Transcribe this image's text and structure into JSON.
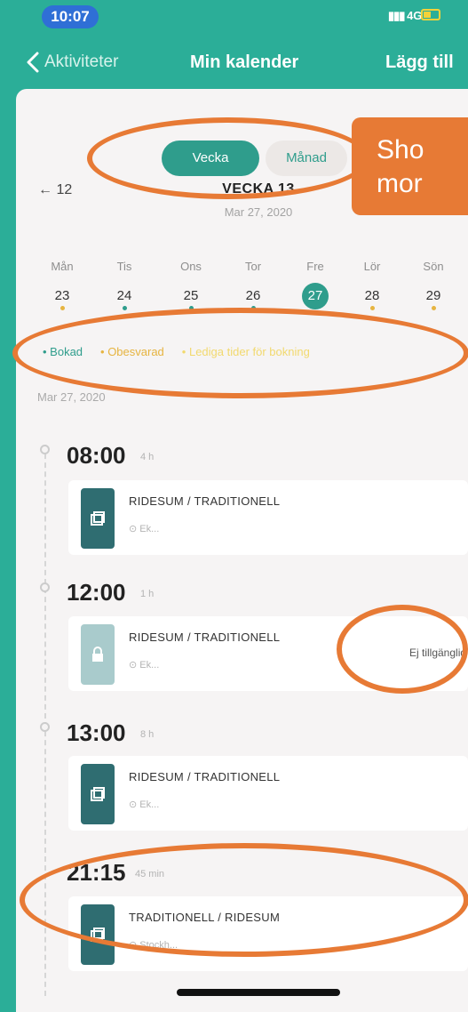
{
  "status_bar": {
    "time": "10:07",
    "network": "4G"
  },
  "nav": {
    "back_label": "Aktiviteter",
    "title": "Min kalender",
    "add_label": "Lägg till"
  },
  "view_toggle": {
    "week": "Vecka",
    "month": "Månad",
    "selected": "Vecka"
  },
  "week": {
    "prev": "← 12",
    "title": "VECKA 13",
    "date": "Mar 27, 2020"
  },
  "days": [
    {
      "name": "Mån",
      "date": "23",
      "dot": "#e6b440"
    },
    {
      "name": "Tis",
      "date": "24",
      "dot": "#2f9d8c"
    },
    {
      "name": "Ons",
      "date": "25",
      "dot": "#2f9d8c"
    },
    {
      "name": "Tor",
      "date": "26",
      "dot": "#2f9d8c"
    },
    {
      "name": "Fre",
      "date": "27",
      "dot": "",
      "selected": true
    },
    {
      "name": "Lör",
      "date": "28",
      "dot": "#e6b440"
    },
    {
      "name": "Sön",
      "date": "29",
      "dot": "#e6b440"
    }
  ],
  "legend": {
    "booked": "• Bokad",
    "unanswered": "• Obesvarad",
    "available": "• Lediga tider för bokning"
  },
  "list_date": "Mar 27, 2020",
  "slots": [
    {
      "time": "08:00",
      "duration": "4 h",
      "title": "RIDESUM / TRADITIONELL",
      "location": "Ek...",
      "status": ""
    },
    {
      "time": "12:00",
      "duration": "1 h",
      "title": "RIDESUM / TRADITIONELL",
      "location": "Ek...",
      "status": "Ej tillgänglig"
    },
    {
      "time": "13:00",
      "duration": "8 h",
      "title": "RIDESUM / TRADITIONELL",
      "location": "Ek...",
      "status": ""
    },
    {
      "time": "21:15",
      "duration": "45 min",
      "title": "TRADITIONELL / RIDESUM",
      "location": "Stockh...",
      "status": ""
    }
  ],
  "annotation": {
    "callout_text": "Sho\nmor",
    "color": "#e77a35"
  },
  "colors": {
    "brand": "#2bae98",
    "accent": "#2f9d8c",
    "pending": "#e6b440"
  }
}
